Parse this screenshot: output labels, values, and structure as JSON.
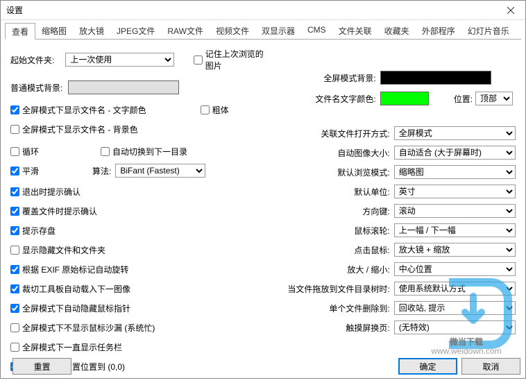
{
  "window": {
    "title": "设置"
  },
  "tabs": [
    "查看",
    "缩略图",
    "放大镜",
    "JPEG文件",
    "RAW文件",
    "视频文件",
    "双显示器",
    "CMS",
    "文件关联",
    "收藏夹",
    "外部程序",
    "幻灯片音乐"
  ],
  "activeTab": 0,
  "left": {
    "startFolderLabel": "起始文件夹:",
    "startFolderValue": "上一次使用",
    "rememberLastImage": "记住上次浏览的图片",
    "normalBgLabel": "普通模式背景:",
    "normalBgColor": "#e0e0e0",
    "showFilenameFg": "全屏模式下显示文件名 - 文字颜色",
    "bold": "粗体",
    "showFilenameBg": "全屏模式下显示文件名 - 背景色",
    "loop": "循环",
    "autoNextDir": "自动切换到下一目录",
    "smooth": "平滑",
    "algoLabel": "算法:",
    "algoValue": "BiFant (Fastest)",
    "confirmExit": "退出时提示确认",
    "confirmOverwrite": "覆盖文件时提示确认",
    "confirmSave": "提示存盘",
    "showHidden": "显示隐藏文件和文件夹",
    "autoRotateExif": "根据 EXIF 原始标记自动旋转",
    "loadNextInCrop": "裁切工具板自动载入下一图像",
    "hideCursorFull": "全屏模式下自动隐藏鼠标指针",
    "noSandFull": "全屏模式下不显示鼠标沙漏 (系统忙)",
    "taskbarFull": "全屏模式下一直显示任务栏",
    "resetPosOnRead": "读取图像时重置位置到 (0,0)"
  },
  "right": {
    "fullBgLabel": "全屏模式背景:",
    "fullBgColor": "#000000",
    "filenameColorLabel": "文件名文字颜色:",
    "filenameColor": "#00ff00",
    "positionLabel": "位置:",
    "positionValue": "顶部",
    "linkedOpenLabel": "关联文件打开方式:",
    "linkedOpenValue": "全屏模式",
    "autoSizeLabel": "自动图像大小:",
    "autoSizeValue": "自动适合 (大于屏幕时)",
    "browseModeLabel": "默认浏览模式:",
    "browseModeValue": "缩略图",
    "unitLabel": "默认单位:",
    "unitValue": "英寸",
    "arrowLabel": "方向键:",
    "arrowValue": "滚动",
    "wheelLabel": "鼠标滚轮:",
    "wheelValue": "上一幅 / 下一幅",
    "clickLabel": "点击鼠标:",
    "clickValue": "放大镜 + 缩放",
    "zoomLabel": "放大 / 缩小:",
    "zoomValue": "中心位置",
    "dropLabel": "当文件拖放到文件目录树时:",
    "dropValue": "使用系统默认方式",
    "deleteLabel": "单个文件删除到:",
    "deleteValue": "回收站, 提示",
    "touchLabel": "触摸屏换页:",
    "touchValue": "(无特效)"
  },
  "footer": {
    "reset": "重置",
    "ok": "确定",
    "cancel": "取消"
  },
  "watermark": {
    "text1": "微当下载",
    "text2": "www.weidown.com"
  }
}
